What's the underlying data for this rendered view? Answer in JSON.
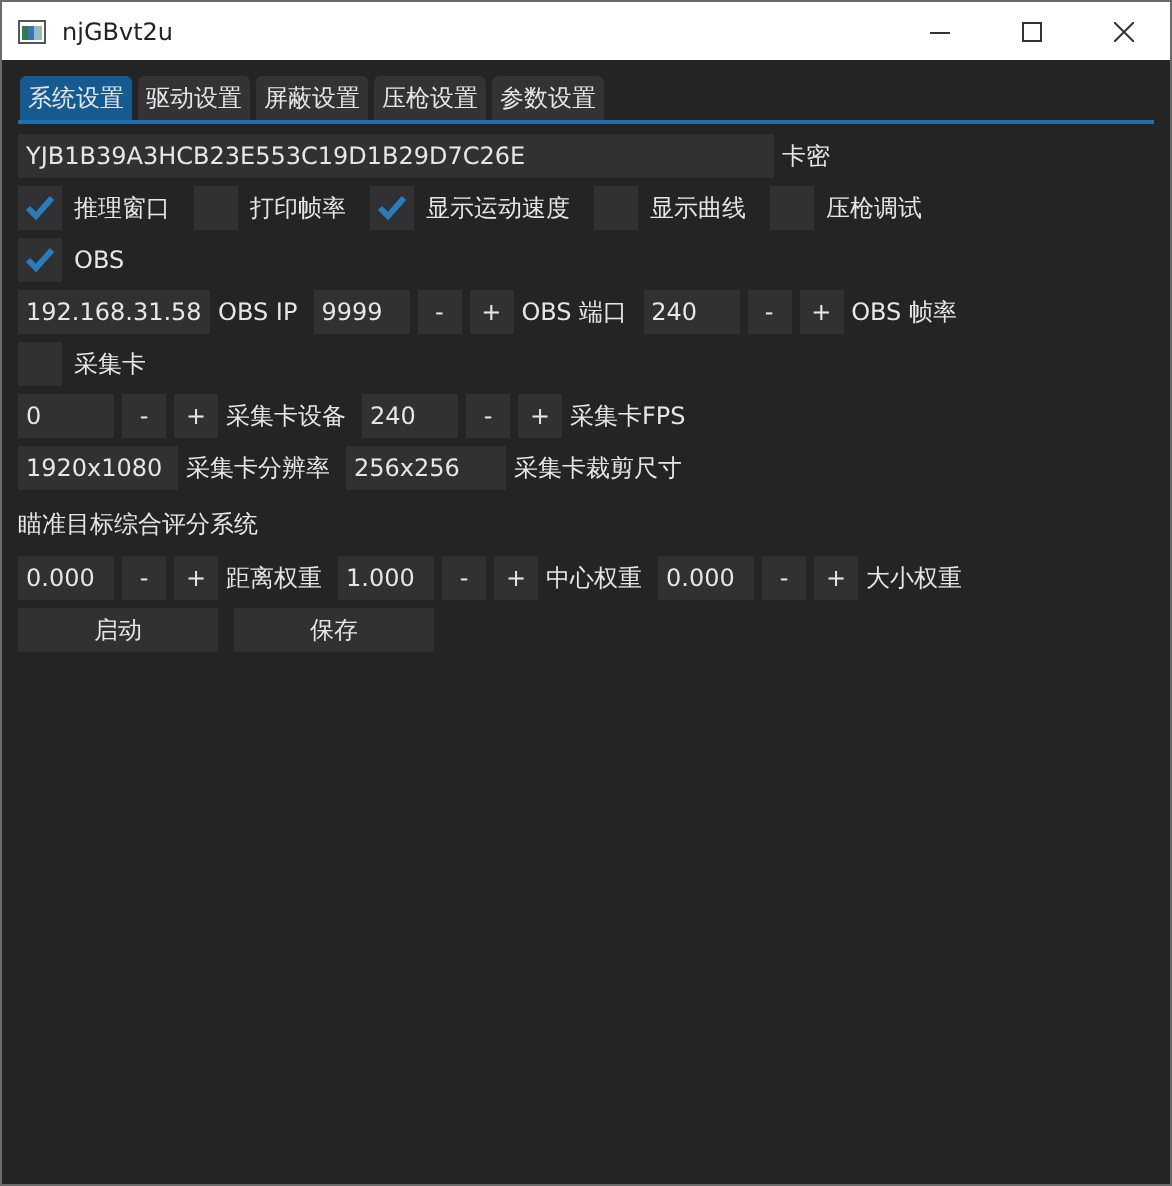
{
  "window": {
    "title": "njGBvt2u"
  },
  "tabs": [
    {
      "label": "系统设置",
      "selected": true
    },
    {
      "label": "驱动设置",
      "selected": false
    },
    {
      "label": "屏蔽设置",
      "selected": false
    },
    {
      "label": "压枪设置",
      "selected": false
    },
    {
      "label": "参数设置",
      "selected": false
    }
  ],
  "rows": [
    {
      "items": [
        {
          "kind": "key",
          "value": "YJB1B39A3HCB23E553C19D1B29D7C26E"
        },
        {
          "kind": "label",
          "text": "卡密"
        }
      ]
    },
    {
      "items": [
        {
          "kind": "check",
          "label": "推理窗口",
          "checked": true
        },
        {
          "kind": "check",
          "label": "打印帧率",
          "checked": false
        },
        {
          "kind": "check",
          "label": "显示运动速度",
          "checked": true
        },
        {
          "kind": "check",
          "label": "显示曲线",
          "checked": false
        },
        {
          "kind": "check",
          "label": "压枪调试",
          "checked": false
        }
      ]
    },
    {
      "items": [
        {
          "kind": "check",
          "label": "OBS",
          "checked": true
        }
      ]
    },
    {
      "items": [
        {
          "kind": "field",
          "value": "192.168.31.58"
        },
        {
          "kind": "label",
          "text": "OBS IP"
        },
        {
          "kind": "spin",
          "value": "9999",
          "minus": "-",
          "plus": "+"
        },
        {
          "kind": "label",
          "text": "OBS 端口"
        },
        {
          "kind": "spin",
          "value": "240",
          "minus": "-",
          "plus": "+"
        },
        {
          "kind": "label",
          "text": "OBS 帧率"
        }
      ]
    },
    {
      "items": [
        {
          "kind": "check",
          "label": "采集卡",
          "checked": false
        }
      ]
    },
    {
      "items": [
        {
          "kind": "spin",
          "value": "0",
          "minus": "-",
          "plus": "+"
        },
        {
          "kind": "label",
          "text": "采集卡设备"
        },
        {
          "kind": "spin",
          "value": "240",
          "minus": "-",
          "plus": "+"
        },
        {
          "kind": "label",
          "text": "采集卡FPS"
        }
      ]
    },
    {
      "items": [
        {
          "kind": "short",
          "value": "1920x1080"
        },
        {
          "kind": "label",
          "text": "采集卡分辨率"
        },
        {
          "kind": "short",
          "value": "256x256"
        },
        {
          "kind": "label",
          "text": "采集卡裁剪尺寸"
        }
      ]
    },
    {
      "items": [
        {
          "kind": "heading",
          "text": "瞄准目标综合评分系统"
        }
      ]
    },
    {
      "items": [
        {
          "kind": "spin",
          "value": "0.000",
          "minus": "-",
          "plus": "+"
        },
        {
          "kind": "label",
          "text": "距离权重"
        },
        {
          "kind": "spin",
          "value": "1.000",
          "minus": "-",
          "plus": "+"
        },
        {
          "kind": "label",
          "text": "中心权重"
        },
        {
          "kind": "spin",
          "value": "0.000",
          "minus": "-",
          "plus": "+"
        },
        {
          "kind": "label",
          "text": "大小权重"
        }
      ]
    },
    {
      "items": [
        {
          "kind": "button",
          "text": "启动"
        },
        {
          "kind": "button",
          "text": "保存"
        }
      ]
    }
  ]
}
